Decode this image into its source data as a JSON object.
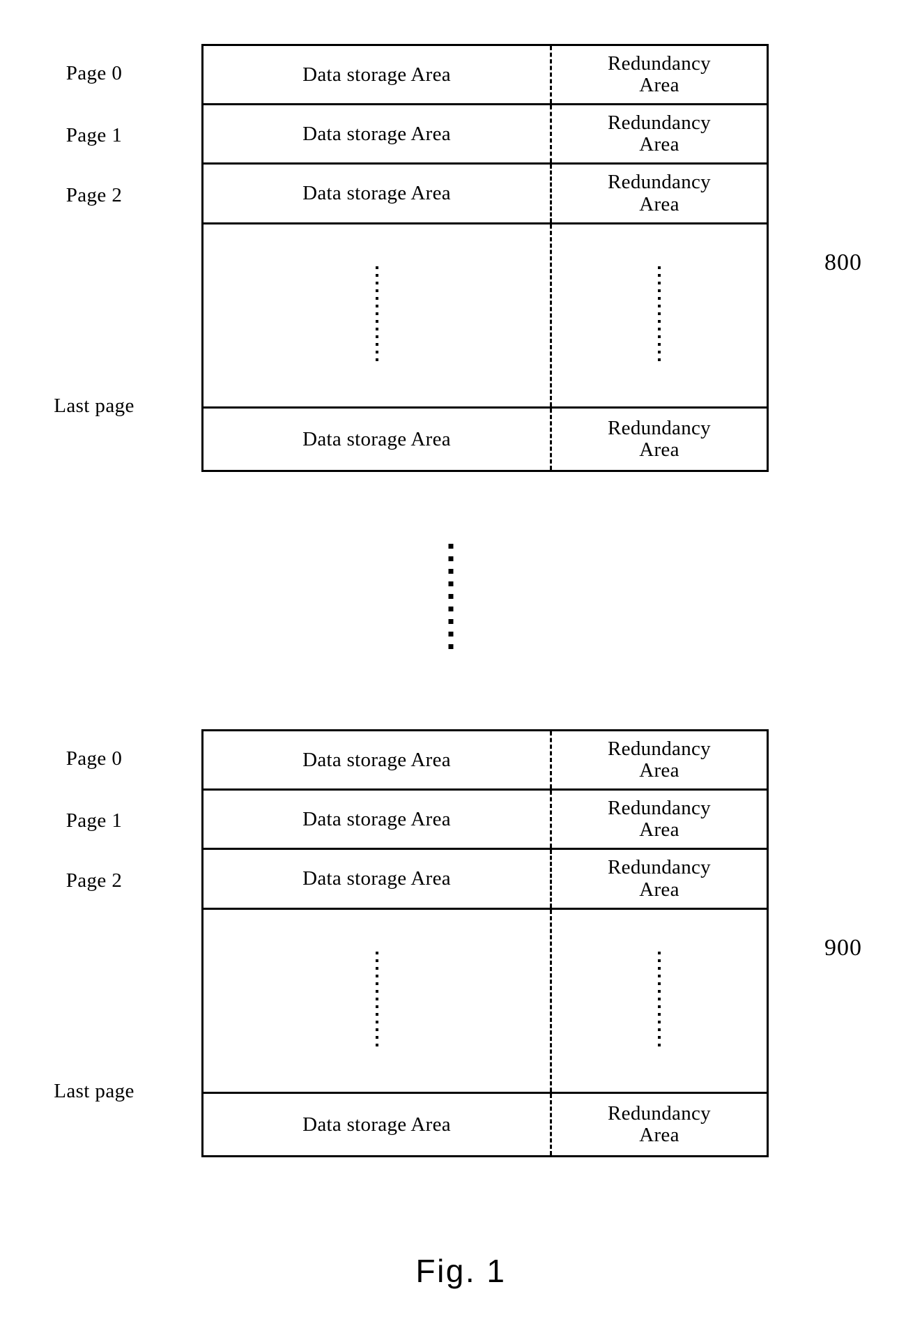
{
  "figure": {
    "caption": "Fig. 1"
  },
  "column_headers": {
    "data_area": "Data storage Area",
    "redundancy_area_line1": "Redundancy",
    "redundancy_area_line2": "Area"
  },
  "blocks": [
    {
      "reference_number": "800",
      "rows": [
        {
          "label": "Page 0",
          "data_cell": "Data storage Area",
          "redundancy_cell_line1": "Redundancy",
          "redundancy_cell_line2": "Area"
        },
        {
          "label": "Page 1",
          "data_cell": "Data storage Area",
          "redundancy_cell_line1": "Redundancy",
          "redundancy_cell_line2": "Area"
        },
        {
          "label": "Page 2",
          "data_cell": "Data storage Area",
          "redundancy_cell_line1": "Redundancy",
          "redundancy_cell_line2": "Area"
        },
        {
          "label": "",
          "data_cell": "",
          "redundancy_cell_line1": "",
          "redundancy_cell_line2": ""
        },
        {
          "label": "Last page",
          "data_cell": "Data storage Area",
          "redundancy_cell_line1": "Redundancy",
          "redundancy_cell_line2": "Area"
        }
      ]
    },
    {
      "reference_number": "900",
      "rows": [
        {
          "label": "Page 0",
          "data_cell": "Data storage Area",
          "redundancy_cell_line1": "Redundancy",
          "redundancy_cell_line2": "Area"
        },
        {
          "label": "Page 1",
          "data_cell": "Data storage Area",
          "redundancy_cell_line1": "Redundancy",
          "redundancy_cell_line2": "Area"
        },
        {
          "label": "Page 2",
          "data_cell": "Data storage Area",
          "redundancy_cell_line1": "Redundancy",
          "redundancy_cell_line2": "Area"
        },
        {
          "label": "",
          "data_cell": "",
          "redundancy_cell_line1": "",
          "redundancy_cell_line2": ""
        },
        {
          "label": "Last page",
          "data_cell": "Data storage Area",
          "redundancy_cell_line1": "Redundancy",
          "redundancy_cell_line2": "Area"
        }
      ]
    }
  ]
}
